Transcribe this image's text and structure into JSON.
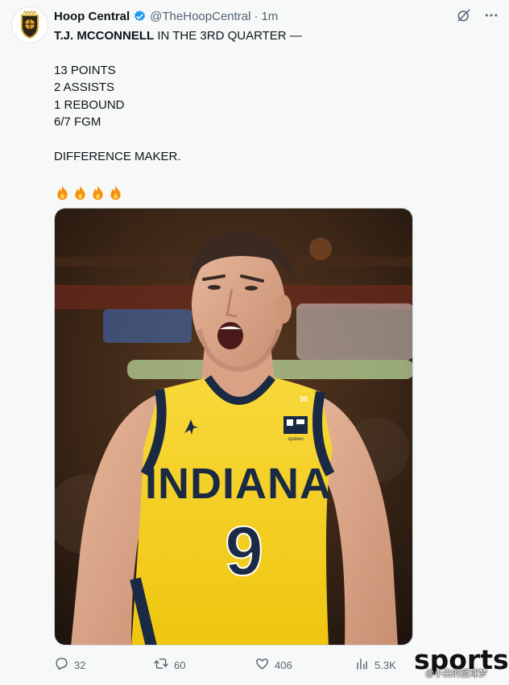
{
  "author": {
    "display_name": "Hoop Central",
    "handle": "@TheHoopCentral",
    "separator": "·",
    "time": "1m"
  },
  "tweet": {
    "line1_name": "T.J. MCCONNELL",
    "line1_rest": " IN THE 3RD QUARTER —",
    "stats": [
      "13 POINTS",
      "2 ASSISTS",
      "1 REBOUND",
      "6/7 FGM"
    ],
    "tagline": "DIFFERENCE MAKER.",
    "emojis": [
      "🔥",
      "🔥",
      "🔥",
      "🔥"
    ]
  },
  "media": {
    "jersey_text": "INDIANA",
    "jersey_number": "9",
    "collar_number": "30",
    "patch_text": "spokeo",
    "colors": {
      "jersey_yellow": "#f6d21f",
      "navy": "#1b2a44"
    }
  },
  "actions": {
    "replies": "32",
    "reposts": "60",
    "likes": "406",
    "views": "5.3K"
  },
  "watermark": {
    "brand": "sports",
    "caption": "@小白的篮球梦"
  },
  "colors": {
    "background": "#f7f8f8",
    "verified_blue": "#1d9bf0",
    "secondary_text": "#536471"
  },
  "icons": {
    "verified": "verified-badge-icon",
    "grok": "grok-icon",
    "more": "more-icon",
    "reply": "reply-icon",
    "repost": "repost-icon",
    "like": "like-icon",
    "views": "views-icon"
  }
}
